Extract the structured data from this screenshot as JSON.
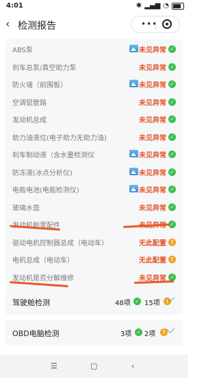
{
  "status_bar": {
    "time": "4:01"
  },
  "header": {
    "title": "检测报告",
    "menu": "•••"
  },
  "report_items": [
    {
      "label": "ABS泵",
      "has_image": true,
      "status": "未见异常",
      "status_type": "ok"
    },
    {
      "label": "刹车总泵/真空助力泵",
      "has_image": false,
      "status": "未见异常",
      "status_type": "ok"
    },
    {
      "label": "防火墙（前围板）",
      "has_image": true,
      "status": "未见异常",
      "status_type": "ok"
    },
    {
      "label": "空调铝管路",
      "has_image": false,
      "status": "未见异常",
      "status_type": "ok"
    },
    {
      "label": "发动机总成",
      "has_image": false,
      "status": "未见异常",
      "status_type": "ok"
    },
    {
      "label": "助力油液位(电子助力无助力油)",
      "has_image": false,
      "status": "未见异常",
      "status_type": "ok"
    },
    {
      "label": "刹车制动液（含水量检测仪",
      "has_image": true,
      "status": "未见异常",
      "status_type": "ok"
    },
    {
      "label": "防冻液(冰点分析仪)",
      "has_image": true,
      "status": "未见异常",
      "status_type": "ok"
    },
    {
      "label": "电瓶电池(电瓶检测仪)",
      "has_image": true,
      "status": "未见异常",
      "status_type": "ok"
    },
    {
      "label": "玻璃水壶",
      "has_image": false,
      "status": "未见异常",
      "status_type": "ok"
    },
    {
      "label": "发动机舱零配件",
      "has_image": false,
      "status": "未见异常",
      "status_type": "ok"
    },
    {
      "label": "驱动电机控制器总成（电动车）",
      "has_image": false,
      "status": "无此配置",
      "status_type": "warn"
    },
    {
      "label": "电机总成（电动车）",
      "has_image": false,
      "status": "无此配置",
      "status_type": "warn"
    },
    {
      "label": "发动机是否分解维修",
      "has_image": false,
      "status": "未见异常",
      "status_type": "ok"
    }
  ],
  "sections": [
    {
      "name": "驾驶舱检测",
      "ok_count": "48项",
      "warn_count": "15项"
    },
    {
      "name": "OBD电脑检测",
      "ok_count": "3项",
      "warn_count": "2项"
    }
  ],
  "colors": {
    "accent": "#e2572b",
    "ok": "#3cbf4a",
    "warn": "#f1a21b"
  }
}
